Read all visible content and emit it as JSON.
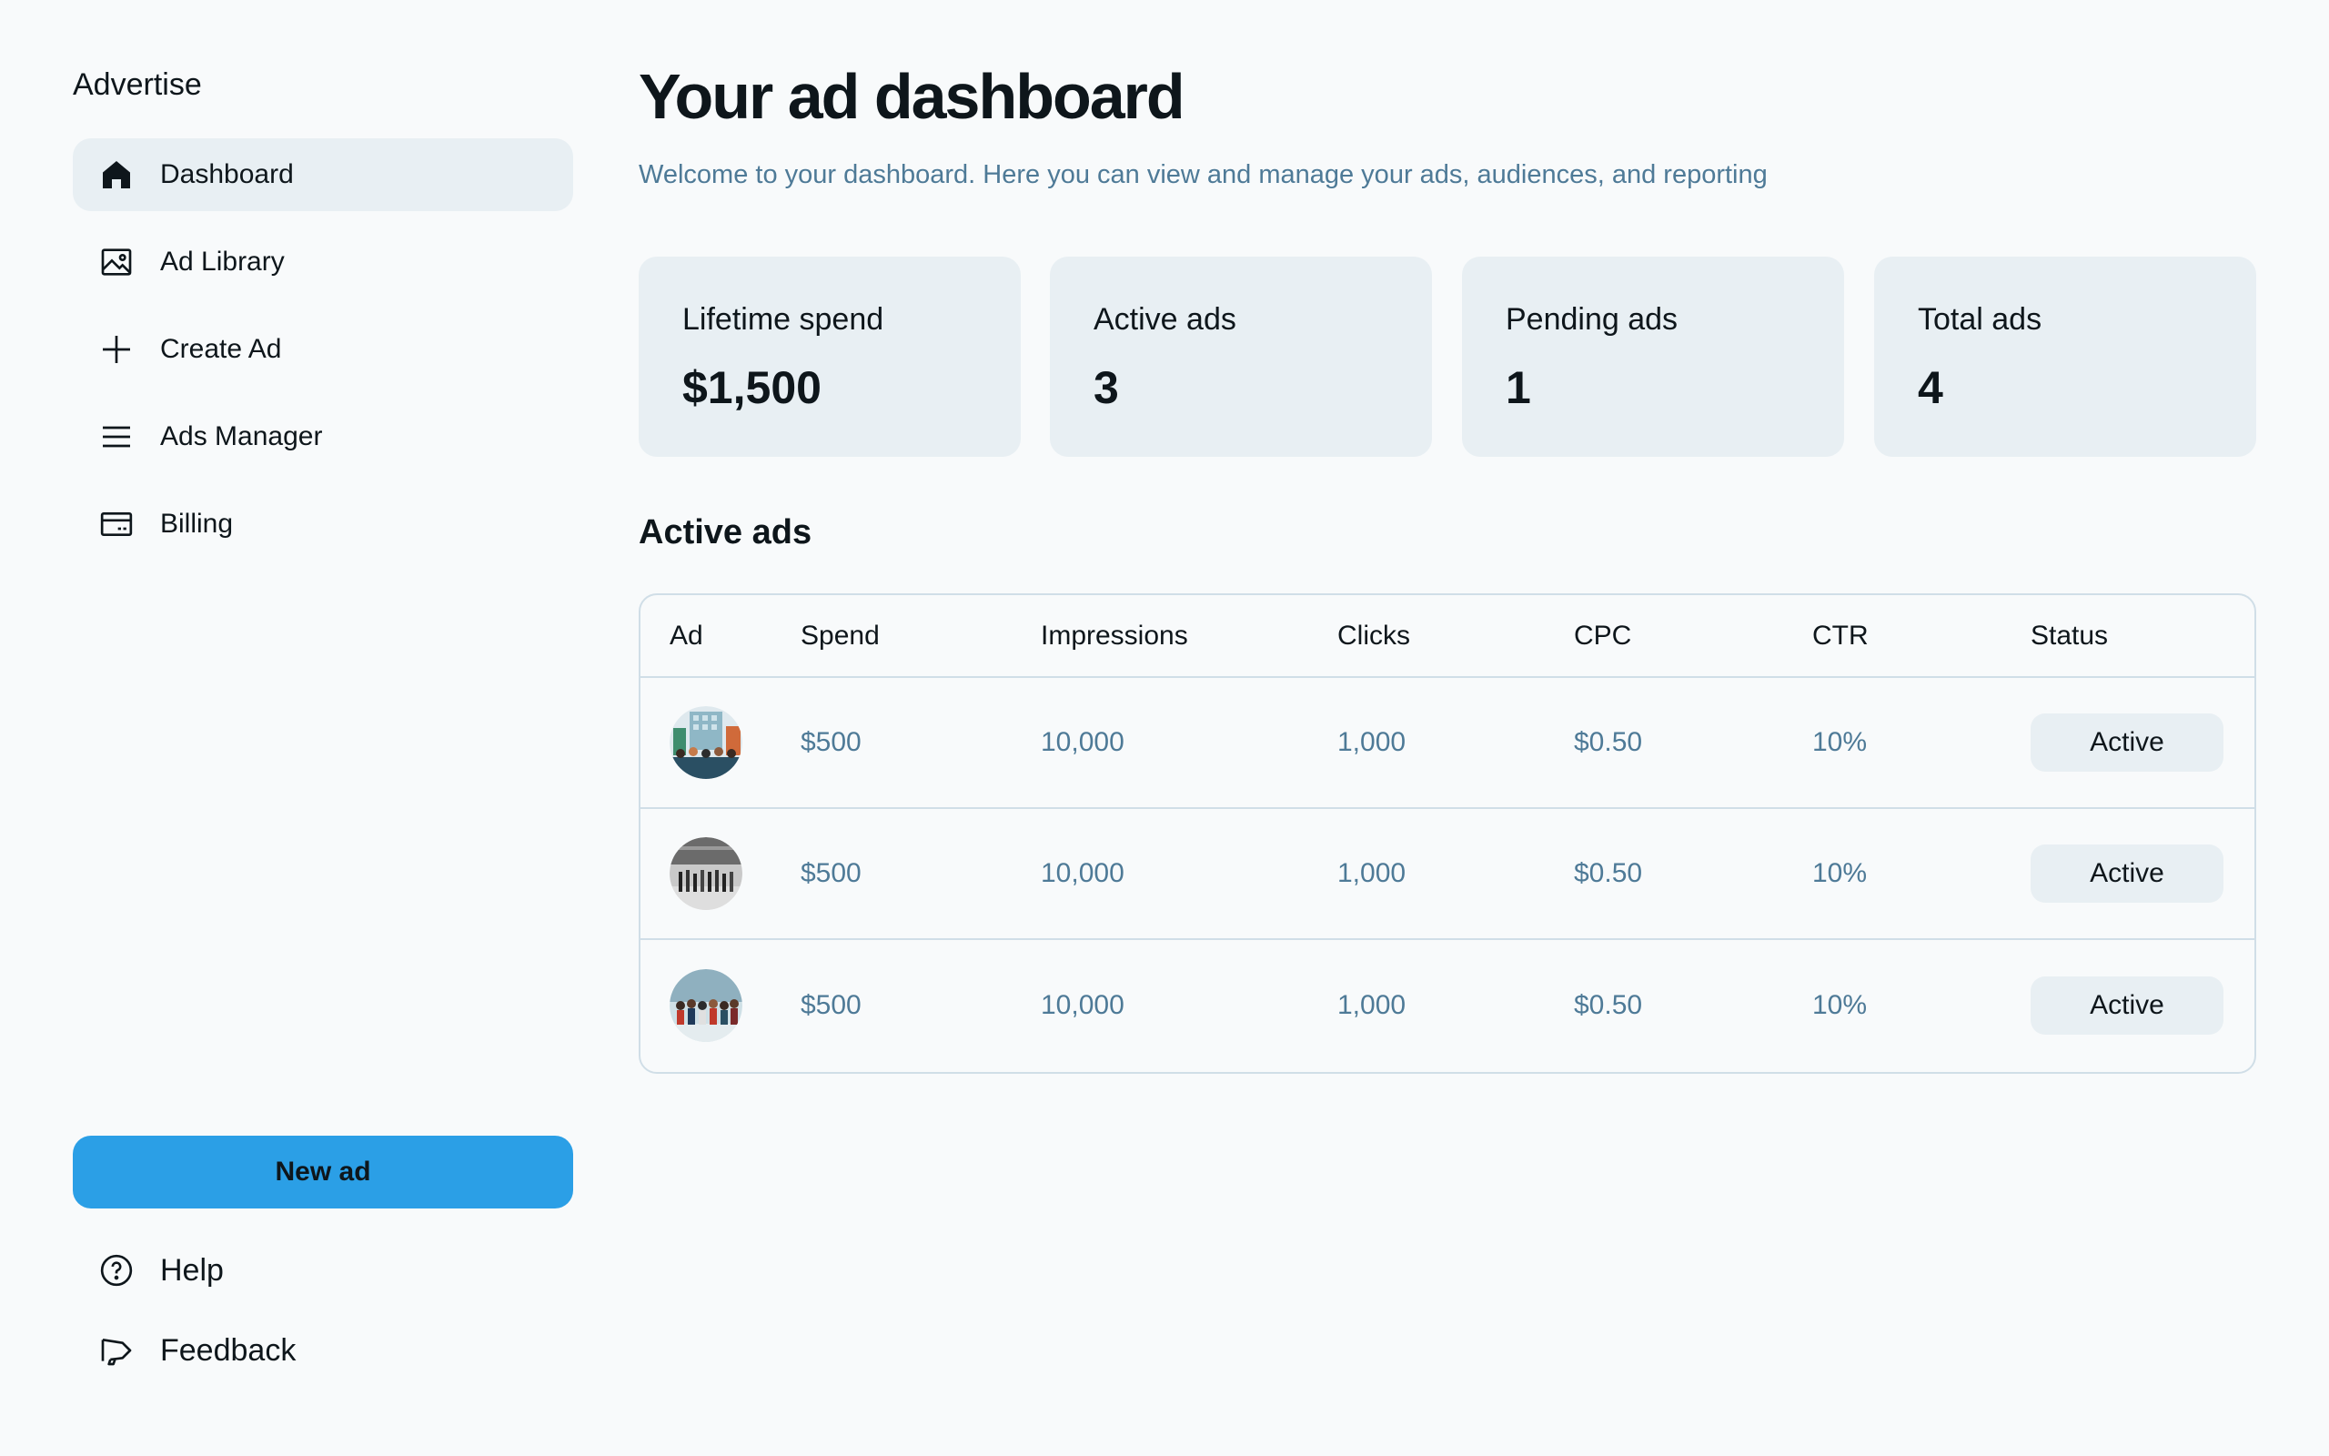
{
  "sidebar": {
    "brand": "Advertise",
    "items": [
      {
        "label": "Dashboard",
        "icon": "home-icon",
        "active": true
      },
      {
        "label": "Ad Library",
        "icon": "image-icon",
        "active": false
      },
      {
        "label": "Create Ad",
        "icon": "plus-icon",
        "active": false
      },
      {
        "label": "Ads Manager",
        "icon": "list-icon",
        "active": false
      },
      {
        "label": "Billing",
        "icon": "credit-card-icon",
        "active": false
      }
    ],
    "new_ad_label": "New ad",
    "help_label": "Help",
    "feedback_label": "Feedback"
  },
  "main": {
    "title": "Your ad dashboard",
    "subtitle": "Welcome to your dashboard. Here you can view and manage your ads, audiences, and reporting",
    "stats": [
      {
        "label": "Lifetime spend",
        "value": "$1,500"
      },
      {
        "label": "Active ads",
        "value": "3"
      },
      {
        "label": "Pending ads",
        "value": "1"
      },
      {
        "label": "Total ads",
        "value": "4"
      }
    ],
    "section_title": "Active ads",
    "table": {
      "headers": [
        "Ad",
        "Spend",
        "Impressions",
        "Clicks",
        "CPC",
        "CTR",
        "Status"
      ],
      "rows": [
        {
          "spend": "$500",
          "impressions": "10,000",
          "clicks": "1,000",
          "cpc": "$0.50",
          "ctr": "10%",
          "status": "Active"
        },
        {
          "spend": "$500",
          "impressions": "10,000",
          "clicks": "1,000",
          "cpc": "$0.50",
          "ctr": "10%",
          "status": "Active"
        },
        {
          "spend": "$500",
          "impressions": "10,000",
          "clicks": "1,000",
          "cpc": "$0.50",
          "ctr": "10%",
          "status": "Active"
        }
      ]
    }
  },
  "colors": {
    "background": "#f8fafb",
    "accent": "#2b9fe6",
    "card": "#e8eff3",
    "muted_text": "#4e7a97",
    "border": "#d0dee7"
  }
}
